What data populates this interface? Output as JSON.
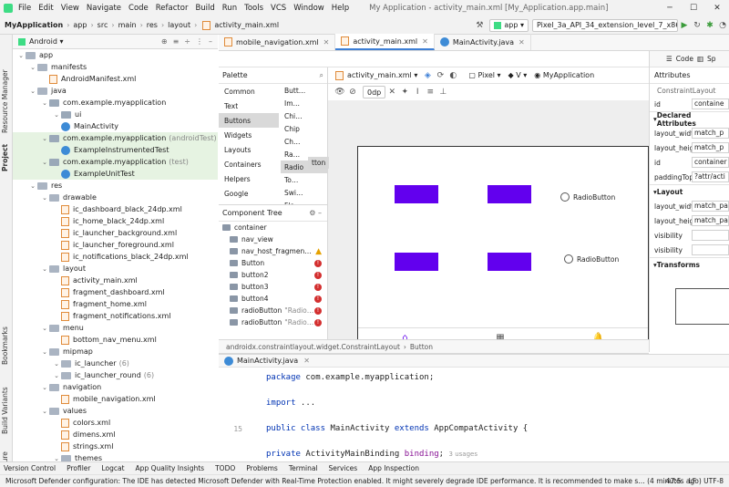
{
  "menu": {
    "items": [
      "File",
      "Edit",
      "View",
      "Navigate",
      "Code",
      "Refactor",
      "Build",
      "Run",
      "Tools",
      "VCS",
      "Window",
      "Help"
    ],
    "window_title": "My Application - activity_main.xml [My_Application.app.main]"
  },
  "nav": {
    "crumbs": [
      "MyApplication",
      "app",
      "src",
      "main",
      "res",
      "layout"
    ],
    "file": "activity_main.xml",
    "run_config": "app",
    "device": "Pixel_3a_API_34_extension_level_7_x86"
  },
  "project": {
    "view": "Android",
    "tree": [
      {
        "d": 0,
        "t": "app",
        "ic": "fold"
      },
      {
        "d": 1,
        "t": "manifests",
        "ic": "fold"
      },
      {
        "d": 2,
        "t": "AndroidManifest.xml",
        "ic": "xml"
      },
      {
        "d": 1,
        "t": "java",
        "ic": "fold"
      },
      {
        "d": 2,
        "t": "com.example.myapplication",
        "ic": "pk"
      },
      {
        "d": 3,
        "t": "ui",
        "ic": "pk"
      },
      {
        "d": 3,
        "t": "MainActivity",
        "ic": "java"
      },
      {
        "d": 2,
        "t": "com.example.myapplication",
        "g": "(androidTest)",
        "ic": "pk",
        "hl": 1
      },
      {
        "d": 3,
        "t": "ExampleInstrumentedTest",
        "ic": "java",
        "hl": 1
      },
      {
        "d": 2,
        "t": "com.example.myapplication",
        "g": "(test)",
        "ic": "pk",
        "hl": 1
      },
      {
        "d": 3,
        "t": "ExampleUnitTest",
        "ic": "java",
        "hl": 1
      },
      {
        "d": 1,
        "t": "res",
        "ic": "fold"
      },
      {
        "d": 2,
        "t": "drawable",
        "ic": "fold"
      },
      {
        "d": 3,
        "t": "ic_dashboard_black_24dp.xml",
        "ic": "xml"
      },
      {
        "d": 3,
        "t": "ic_home_black_24dp.xml",
        "ic": "xml"
      },
      {
        "d": 3,
        "t": "ic_launcher_background.xml",
        "ic": "xml"
      },
      {
        "d": 3,
        "t": "ic_launcher_foreground.xml",
        "ic": "xml"
      },
      {
        "d": 3,
        "t": "ic_notifications_black_24dp.xml",
        "ic": "xml"
      },
      {
        "d": 2,
        "t": "layout",
        "ic": "fold"
      },
      {
        "d": 3,
        "t": "activity_main.xml",
        "ic": "xml"
      },
      {
        "d": 3,
        "t": "fragment_dashboard.xml",
        "ic": "xml"
      },
      {
        "d": 3,
        "t": "fragment_home.xml",
        "ic": "xml"
      },
      {
        "d": 3,
        "t": "fragment_notifications.xml",
        "ic": "xml"
      },
      {
        "d": 2,
        "t": "menu",
        "ic": "fold"
      },
      {
        "d": 3,
        "t": "bottom_nav_menu.xml",
        "ic": "xml"
      },
      {
        "d": 2,
        "t": "mipmap",
        "ic": "fold"
      },
      {
        "d": 3,
        "t": "ic_launcher",
        "g": "(6)",
        "ic": "fold"
      },
      {
        "d": 3,
        "t": "ic_launcher_round",
        "g": "(6)",
        "ic": "fold"
      },
      {
        "d": 2,
        "t": "navigation",
        "ic": "fold"
      },
      {
        "d": 3,
        "t": "mobile_navigation.xml",
        "ic": "xml"
      },
      {
        "d": 2,
        "t": "values",
        "ic": "fold"
      },
      {
        "d": 3,
        "t": "colors.xml",
        "ic": "xml"
      },
      {
        "d": 3,
        "t": "dimens.xml",
        "ic": "xml"
      },
      {
        "d": 3,
        "t": "strings.xml",
        "ic": "xml"
      },
      {
        "d": 3,
        "t": "themes",
        "ic": "fold"
      }
    ]
  },
  "left_strip": [
    "Resource Manager",
    "Project",
    "Bookmarks",
    "Build Variants",
    "Structure"
  ],
  "tabs": [
    "mobile_navigation.xml",
    "activity_main.xml",
    "MainActivity.java"
  ],
  "palette": {
    "title": "Palette",
    "categories": [
      "Common",
      "Text",
      "Buttons",
      "Widgets",
      "Layouts",
      "Containers",
      "Helpers",
      "Google"
    ],
    "items": [
      "Butt…",
      "Im…",
      "Chi…",
      "Chip",
      "Ch…",
      "Ra…",
      "Radio",
      "To…",
      "Swi…",
      "Flo…"
    ]
  },
  "component_tree": {
    "title": "Component Tree",
    "rows": [
      {
        "t": "container",
        "d": 0
      },
      {
        "t": "nav_view",
        "d": 1
      },
      {
        "t": "nav_host_fragmen…",
        "d": 1,
        "w": 1
      },
      {
        "t": "Button",
        "d": 1,
        "e": 1
      },
      {
        "t": "button2",
        "d": 1,
        "e": 1
      },
      {
        "t": "button3",
        "d": 1,
        "e": 1
      },
      {
        "t": "button4",
        "d": 1,
        "e": 1
      },
      {
        "t": "radioButton",
        "g": "\"Radio…",
        "d": 1,
        "e": 1
      },
      {
        "t": "radioButton",
        "g": "\"Radio…",
        "d": 1,
        "e": 1
      }
    ]
  },
  "layout_toolbar": {
    "file": "activity_main.xml",
    "device": "Pixel",
    "api": "V",
    "theme": "MyApplication",
    "margin": "0dp"
  },
  "design": {
    "radio1": "RadioButton",
    "radio2": "RadioButton",
    "tooltip": "tton"
  },
  "breadcrumb2": [
    "androidx.constraintlayout.widget.ConstraintLayout",
    "Button"
  ],
  "attributes": {
    "title": "Attributes",
    "class": "ConstraintLayout",
    "id_val": "containe",
    "declared": "Declared Attributes",
    "rows": [
      [
        "layout_width",
        "match_p"
      ],
      [
        "layout_height",
        "match_p"
      ],
      [
        "id",
        "container"
      ],
      [
        "paddingTop",
        "?attr/acti"
      ]
    ],
    "layout_head": "Layout",
    "layout_rows": [
      [
        "layout_width",
        "match_pa"
      ],
      [
        "layout_height",
        "match_pa"
      ],
      [
        "visibility",
        ""
      ],
      [
        "visibility",
        ""
      ]
    ],
    "transforms": "Transforms",
    "modes": [
      "Code",
      "Sp"
    ]
  },
  "code": {
    "tab": "MainActivity.java",
    "lines": [
      {
        "n": "",
        "html": "<span class='kw'>package</span> com.example.myapplication;"
      },
      {
        "n": "",
        "html": ""
      },
      {
        "n": "",
        "html": "<span class='kw'>import</span> ..."
      },
      {
        "n": "",
        "html": ""
      },
      {
        "n": "15",
        "html": "<span class='kw'>public class</span> MainActivity <span class='kw'>extends</span> AppCompatActivity {"
      },
      {
        "n": "",
        "html": ""
      },
      {
        "n": "",
        "html": "    <span class='kw'>private</span> ActivityMainBinding <span style='color:#871094'>binding</span>; <span style='color:#999;font-size:7px;font-family:DejaVu Sans,sans-serif'>3 usages</span>"
      }
    ]
  },
  "toolwindows": [
    "Version Control",
    "Profiler",
    "Logcat",
    "App Quality Insights",
    "TODO",
    "Problems",
    "Terminal",
    "Services",
    "App Inspection"
  ],
  "status": {
    "msg": "Microsoft Defender configuration: The IDE has detected Microsoft Defender with Real-Time Protection enabled. It might severely degrade IDE performance. It is recommended to make s… (4 minutes ago)",
    "pos": "47:5",
    "lf": "LF",
    "enc": "UTF-8"
  }
}
